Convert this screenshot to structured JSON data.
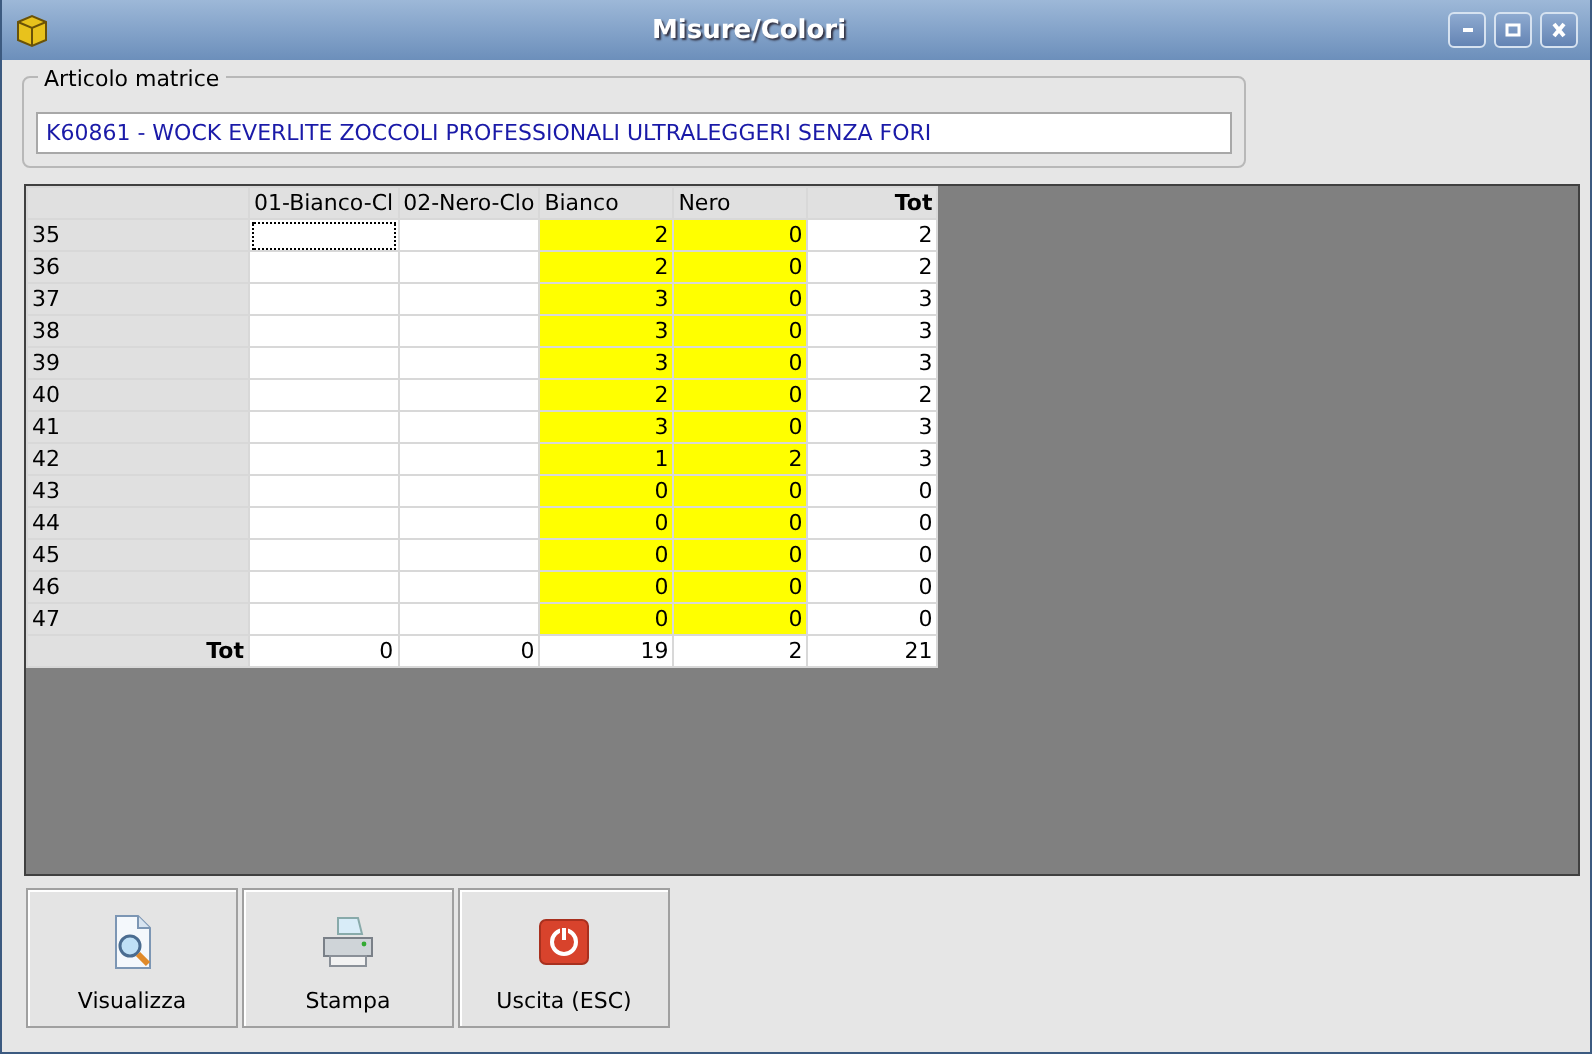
{
  "window": {
    "title": "Misure/Colori"
  },
  "article": {
    "legend": "Articolo matrice",
    "value": "K60861 -  WOCK EVERLITE ZOCCOLI PROFESSIONALI ULTRALEGGERI SENZA FORI"
  },
  "grid": {
    "columns": [
      {
        "label": "01-Bianco-Cl",
        "kind": "size",
        "highlight": false
      },
      {
        "label": "02-Nero-Clo",
        "kind": "size",
        "highlight": false
      },
      {
        "label": "Bianco",
        "kind": "size",
        "highlight": true
      },
      {
        "label": "Nero",
        "kind": "size",
        "highlight": true
      },
      {
        "label": "Tot",
        "kind": "total",
        "highlight": false
      }
    ],
    "rows": [
      {
        "label": "35",
        "cells": [
          {
            "focused": true
          },
          {
            "focused": false
          },
          {
            "value": "2",
            "focused": false
          },
          {
            "value": "0",
            "focused": false
          },
          {
            "value": "2",
            "focused": false
          }
        ]
      },
      {
        "label": "36",
        "cells": [
          {
            "focused": false
          },
          {
            "focused": false
          },
          {
            "value": "2",
            "focused": false
          },
          {
            "value": "0",
            "focused": false
          },
          {
            "value": "2",
            "focused": false
          }
        ]
      },
      {
        "label": "37",
        "cells": [
          {
            "focused": false
          },
          {
            "focused": false
          },
          {
            "value": "3",
            "focused": false
          },
          {
            "value": "0",
            "focused": false
          },
          {
            "value": "3",
            "focused": false
          }
        ]
      },
      {
        "label": "38",
        "cells": [
          {
            "focused": false
          },
          {
            "focused": false
          },
          {
            "value": "3",
            "focused": false
          },
          {
            "value": "0",
            "focused": false
          },
          {
            "value": "3",
            "focused": false
          }
        ]
      },
      {
        "label": "39",
        "cells": [
          {
            "focused": false
          },
          {
            "focused": false
          },
          {
            "value": "3",
            "focused": false
          },
          {
            "value": "0",
            "focused": false
          },
          {
            "value": "3",
            "focused": false
          }
        ]
      },
      {
        "label": "40",
        "cells": [
          {
            "focused": false
          },
          {
            "focused": false
          },
          {
            "value": "2",
            "focused": false
          },
          {
            "value": "0",
            "focused": false
          },
          {
            "value": "2",
            "focused": false
          }
        ]
      },
      {
        "label": "41",
        "cells": [
          {
            "focused": false
          },
          {
            "focused": false
          },
          {
            "value": "3",
            "focused": false
          },
          {
            "value": "0",
            "focused": false
          },
          {
            "value": "3",
            "focused": false
          }
        ]
      },
      {
        "label": "42",
        "cells": [
          {
            "focused": false
          },
          {
            "focused": false
          },
          {
            "value": "1",
            "focused": false
          },
          {
            "value": "2",
            "focused": false
          },
          {
            "value": "3",
            "focused": false
          }
        ]
      },
      {
        "label": "43",
        "cells": [
          {
            "focused": false
          },
          {
            "focused": false
          },
          {
            "value": "0",
            "focused": false
          },
          {
            "value": "0",
            "focused": false
          },
          {
            "value": "0",
            "focused": false
          }
        ]
      },
      {
        "label": "44",
        "cells": [
          {
            "focused": false
          },
          {
            "focused": false
          },
          {
            "value": "0",
            "focused": false
          },
          {
            "value": "0",
            "focused": false
          },
          {
            "value": "0",
            "focused": false
          }
        ]
      },
      {
        "label": "45",
        "cells": [
          {
            "focused": false
          },
          {
            "focused": false
          },
          {
            "value": "0",
            "focused": false
          },
          {
            "value": "0",
            "focused": false
          },
          {
            "value": "0",
            "focused": false
          }
        ]
      },
      {
        "label": "46",
        "cells": [
          {
            "focused": false
          },
          {
            "focused": false
          },
          {
            "value": "0",
            "focused": false
          },
          {
            "value": "0",
            "focused": false
          },
          {
            "value": "0",
            "focused": false
          }
        ]
      },
      {
        "label": "47",
        "cells": [
          {
            "focused": false
          },
          {
            "focused": false
          },
          {
            "value": "0",
            "focused": false
          },
          {
            "value": "0",
            "focused": false
          },
          {
            "value": "0",
            "focused": false
          }
        ]
      }
    ],
    "footer": {
      "label": "Tot",
      "values": [
        "0",
        "0",
        "19",
        "2",
        "21"
      ]
    }
  },
  "buttons": [
    {
      "label": "Visualizza",
      "kind": "preview"
    },
    {
      "label": "Stampa",
      "kind": "print"
    },
    {
      "label": "Uscita (ESC)",
      "kind": "exit"
    }
  ]
}
